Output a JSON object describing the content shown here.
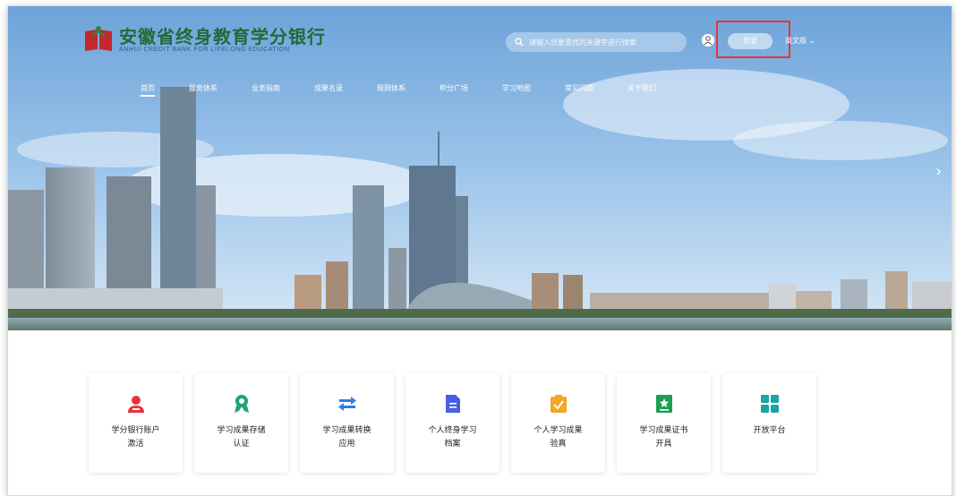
{
  "header": {
    "logo_title": "安徽省终身教育学分银行",
    "logo_subtitle": "ANHUI CREDIT BANK FOR LIFELONG EDUCATION",
    "search_placeholder": "请输入您要查找的关键字进行搜索",
    "login_label": "登录",
    "lang_label": "英文版 ⌄"
  },
  "nav": {
    "items": [
      "首页",
      "服务体系",
      "业务指南",
      "成果名录",
      "规则体系",
      "积分广场",
      "学习地图",
      "常见问题",
      "关于我们"
    ]
  },
  "cards": [
    {
      "line1": "学分银行账户",
      "line2": "激活",
      "icon": "user-icon",
      "color": "#e8333a"
    },
    {
      "line1": "学习成果存储",
      "line2": "认证",
      "icon": "award-icon",
      "color": "#1fa37a"
    },
    {
      "line1": "学习成果转换",
      "line2": "应用",
      "icon": "exchange-icon",
      "color": "#2b7de9"
    },
    {
      "line1": "个人终身学习",
      "line2": "档案",
      "icon": "document-icon",
      "color": "#4a5fe0"
    },
    {
      "line1": "个人学习成果",
      "line2": "验真",
      "icon": "clipboard-check-icon",
      "color": "#f5a623"
    },
    {
      "line1": "学习成果证书",
      "line2": "开具",
      "icon": "certificate-icon",
      "color": "#1e9e55"
    },
    {
      "line1": "开放平台",
      "line2": "",
      "icon": "grid-icon",
      "color": "#1fa3a3"
    }
  ]
}
